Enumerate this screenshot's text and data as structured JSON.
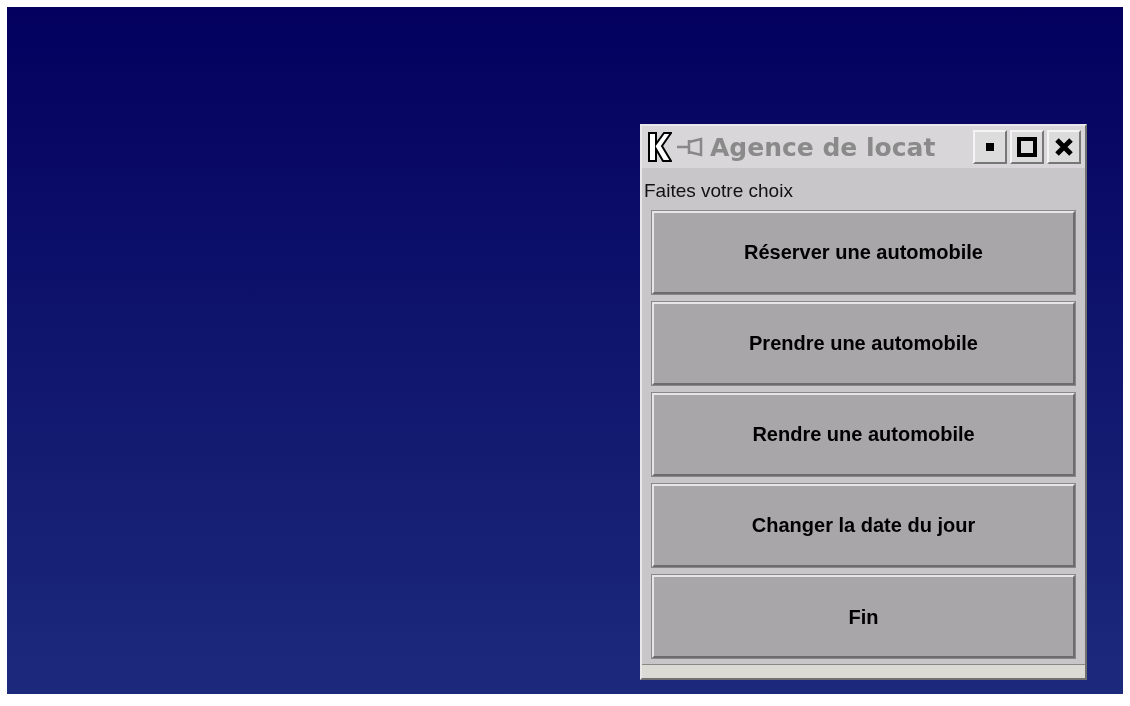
{
  "window": {
    "title": "Agence de locat"
  },
  "prompt": "Faites votre choix",
  "buttons": [
    {
      "label": "Réserver une automobile"
    },
    {
      "label": "Prendre une automobile"
    },
    {
      "label": "Rendre une automobile"
    },
    {
      "label": "Changer la date du jour"
    },
    {
      "label": "Fin"
    }
  ]
}
